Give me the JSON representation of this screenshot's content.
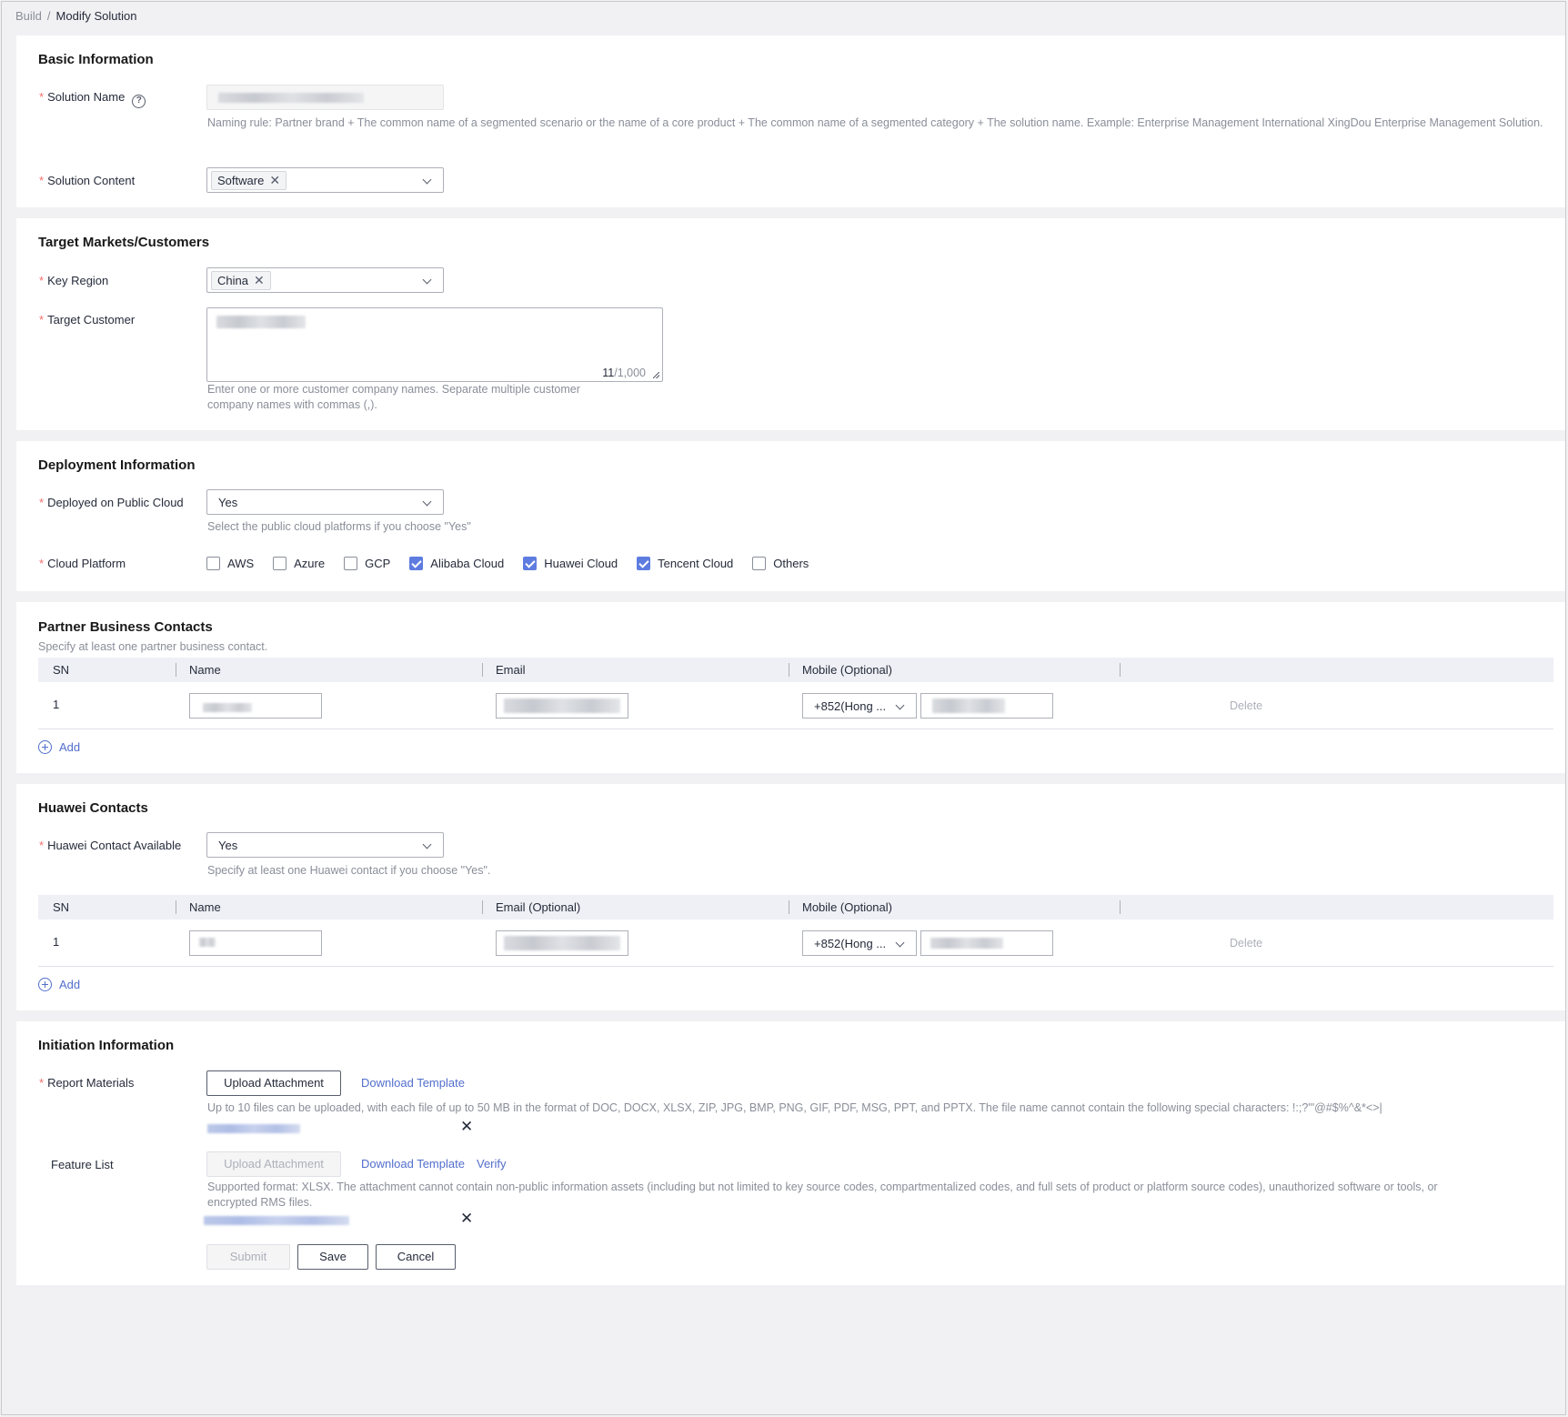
{
  "breadcrumb": {
    "parent": "Build",
    "separator": "/",
    "current": "Modify Solution"
  },
  "basic": {
    "title": "Basic Information",
    "solution_name_label": "Solution Name",
    "solution_name_help": "?",
    "naming_rule": "Naming rule: Partner brand + The common name of a segmented scenario or the name of a core product + The common name of a segmented category + The solution name. Example: Enterprise Management International XingDou Enterprise Management Solution.",
    "solution_content_label": "Solution Content",
    "solution_content_tag": "Software"
  },
  "target": {
    "title": "Target Markets/Customers",
    "key_region_label": "Key Region",
    "key_region_tag": "China",
    "target_customer_label": "Target Customer",
    "counter_current": "11",
    "counter_max": "/1,000",
    "hint_line1": "Enter one or more customer company names. Separate multiple customer",
    "hint_line2": "company names with commas (,)."
  },
  "deployment": {
    "title": "Deployment Information",
    "public_cloud_label": "Deployed on Public Cloud",
    "public_cloud_value": "Yes",
    "public_cloud_hint": "Select the public cloud platforms if you choose \"Yes\"",
    "cloud_platform_label": "Cloud Platform",
    "platforms": [
      {
        "label": "AWS",
        "checked": false
      },
      {
        "label": "Azure",
        "checked": false
      },
      {
        "label": "GCP",
        "checked": false
      },
      {
        "label": "Alibaba Cloud",
        "checked": true
      },
      {
        "label": "Huawei Cloud",
        "checked": true
      },
      {
        "label": "Tencent Cloud",
        "checked": true
      },
      {
        "label": "Others",
        "checked": false
      }
    ]
  },
  "partner_contacts": {
    "title": "Partner Business Contacts",
    "subtitle": "Specify at least one partner business contact.",
    "columns": [
      "SN",
      "Name",
      "Email",
      "Mobile (Optional)"
    ],
    "rows": [
      {
        "sn": "1",
        "country_code": "+852(Hong ...",
        "delete": "Delete"
      }
    ],
    "add": "Add"
  },
  "huawei_contacts": {
    "title": "Huawei Contacts",
    "available_label": "Huawei Contact Available",
    "available_value": "Yes",
    "available_hint": "Specify at least one Huawei contact if you choose \"Yes\".",
    "columns": [
      "SN",
      "Name",
      "Email (Optional)",
      "Mobile (Optional)"
    ],
    "rows": [
      {
        "sn": "1",
        "country_code": "+852(Hong ...",
        "delete": "Delete"
      }
    ],
    "add": "Add"
  },
  "initiation": {
    "title": "Initiation Information",
    "report_label": "Report Materials",
    "upload": "Upload Attachment",
    "download_template": "Download Template",
    "report_hint": "Up to 10 files can be uploaded, with each file of up to 50 MB in the format of DOC, DOCX, XLSX, ZIP, JPG, BMP, PNG, GIF, PDF, MSG, PPT, and PPTX. The file name cannot contain the following special characters: !:;?'\"@#$%^&*<>|",
    "feature_label": "Feature List",
    "verify": "Verify",
    "feature_hint_line1": "Supported format: XLSX. The attachment cannot contain non-public information assets (including but not limited to key source codes, compartmentalized codes, and full sets of product or platform source codes), unauthorized software or tools, or",
    "feature_hint_line2": "encrypted RMS files.",
    "remove": "✕"
  },
  "actions": {
    "submit": "Submit",
    "save": "Save",
    "cancel": "Cancel"
  },
  "colors": {
    "primary": "#5e7ce0",
    "link": "#526ecc",
    "required": "#f66f6a",
    "hint": "#8a8e99"
  }
}
